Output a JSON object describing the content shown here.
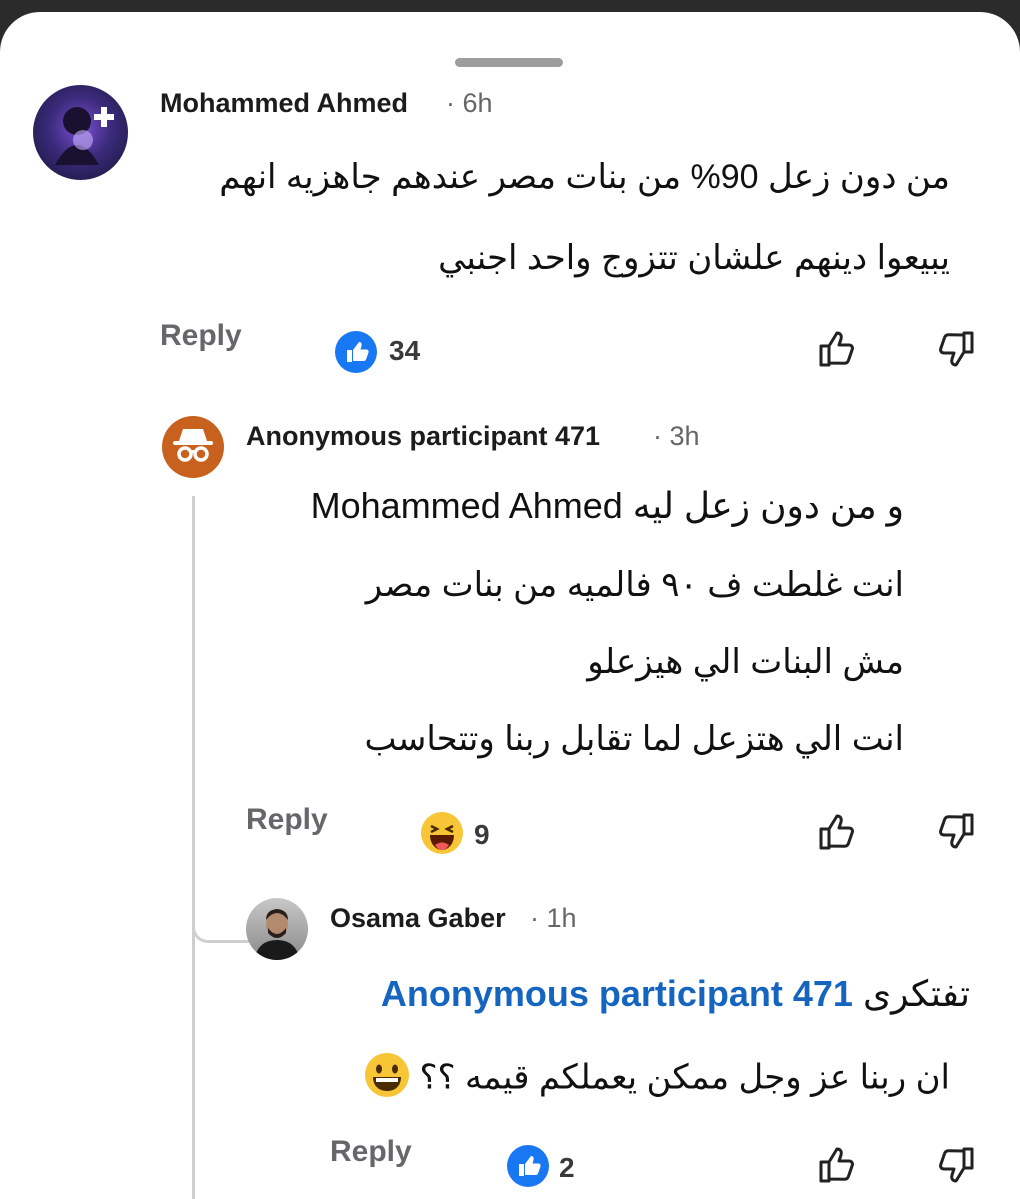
{
  "comments": [
    {
      "author": "Mohammed Ahmed",
      "time": "· 6h",
      "lines": [
        "من دون زعل 90% من بنات مصر عندهم جاهزيه انهم",
        "يبيعوا دينهم علشان تتزوج واحد اجنبي"
      ],
      "reply_label": "Reply",
      "reaction_icon": "like-reaction-icon",
      "reaction_count": "34"
    },
    {
      "author": "Anonymous participant 471",
      "time": "· 3h",
      "lines": [
        "و من دون زعل ليه Mohammed Ahmed",
        "انت غلطت ف ٩٠ فالميه من بنات  مصر",
        "مش البنات الي هيزعلو",
        "انت الي هتزعل لما تقابل ربنا وتتحاسب"
      ],
      "reply_label": "Reply",
      "reaction_icon": "haha-reaction-icon",
      "reaction_count": "9"
    },
    {
      "author": "Osama Gaber",
      "time": "· 1h",
      "mention": "Anonymous participant 471",
      "mention_suffix": "تفتكرى",
      "line2": "ان ربنا عز وجل ممكن يعملكم قيمه ؟؟",
      "reply_label": "Reply",
      "reaction_icon": "like-reaction-icon",
      "reaction_count": "2"
    }
  ],
  "colors": {
    "accent": "#1565c0",
    "like_blue": "#1877f2",
    "anon_orange": "#c8611e"
  }
}
